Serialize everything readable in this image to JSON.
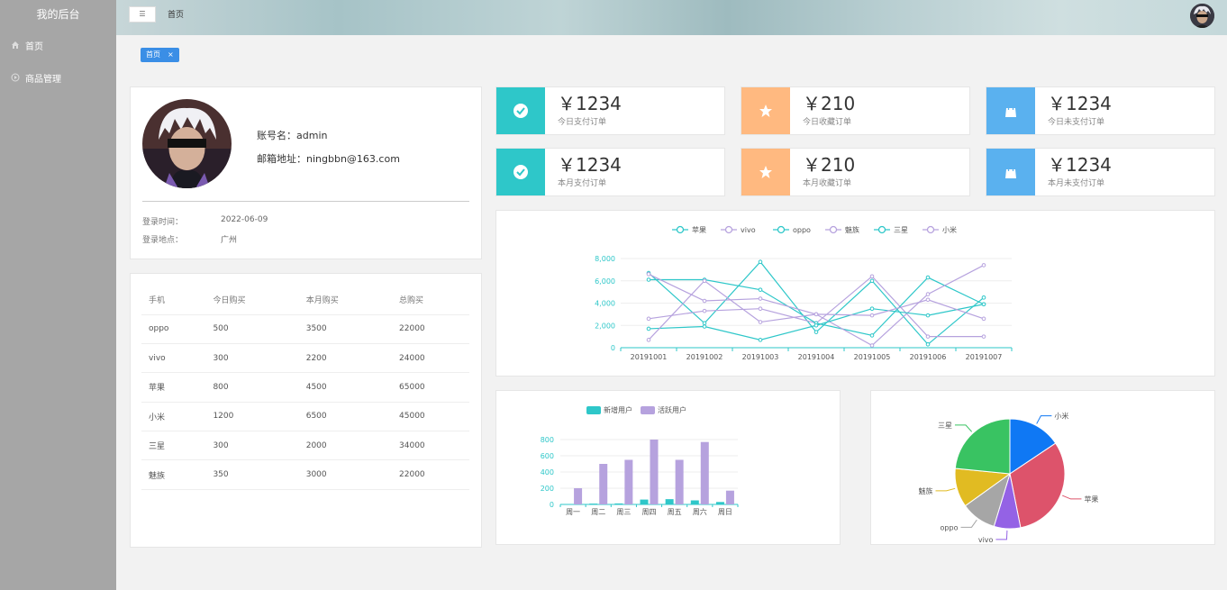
{
  "sidebar": {
    "brand": "我的后台",
    "items": [
      {
        "label": "首页",
        "icon": "home-icon"
      },
      {
        "label": "商品管理",
        "icon": "play-circle-icon"
      }
    ]
  },
  "header": {
    "collapse_label": "☰",
    "breadcrumb": "首页"
  },
  "tabs": [
    {
      "label": "首页",
      "close": "×"
    }
  ],
  "user": {
    "account_label": "账号名：",
    "account": "admin",
    "email_label": "邮箱地址：",
    "email": "ningbbn@163.com",
    "login_time_label": "登录时间：",
    "login_time": "2022-06-09",
    "login_place_label": "登录地点：",
    "login_place": "广州"
  },
  "purchase_table": {
    "headers": [
      "手机",
      "今日购买",
      "本月购买",
      "总购买"
    ],
    "rows": [
      [
        "oppo",
        "500",
        "3500",
        "22000"
      ],
      [
        "vivo",
        "300",
        "2200",
        "24000"
      ],
      [
        "苹果",
        "800",
        "4500",
        "65000"
      ],
      [
        "小米",
        "1200",
        "6500",
        "45000"
      ],
      [
        "三星",
        "300",
        "2000",
        "34000"
      ],
      [
        "魅族",
        "350",
        "3000",
        "22000"
      ]
    ]
  },
  "stats": [
    {
      "value": "￥1234",
      "label": "今日支付订单",
      "icon": "check-circle-icon",
      "color": "#2ec7c9"
    },
    {
      "value": "￥210",
      "label": "今日收藏订单",
      "icon": "star-icon",
      "color": "#ffb980"
    },
    {
      "value": "￥1234",
      "label": "今日未支付订单",
      "icon": "shopping-bag-icon",
      "color": "#5ab1ef"
    },
    {
      "value": "￥1234",
      "label": "本月支付订单",
      "icon": "check-circle-icon",
      "color": "#2ec7c9"
    },
    {
      "value": "￥210",
      "label": "本月收藏订单",
      "icon": "star-icon",
      "color": "#ffb980"
    },
    {
      "value": "￥1234",
      "label": "本月未支付订单",
      "icon": "shopping-bag-icon",
      "color": "#5ab1ef"
    }
  ],
  "chart_data": [
    {
      "type": "line",
      "x": [
        "20191001",
        "20191002",
        "20191003",
        "20191004",
        "20191005",
        "20191006",
        "20191007"
      ],
      "ylim": [
        0,
        8000
      ],
      "yticks": [
        "0",
        "2,000",
        "4,000",
        "6,000",
        "8,000"
      ],
      "legend_position": "top-center",
      "series": [
        {
          "name": "苹果",
          "color": "#2ec7c9",
          "values": [
            6700,
            2200,
            7700,
            1400,
            6000,
            300,
            4500
          ]
        },
        {
          "name": "vivo",
          "color": "#b6a2de",
          "values": [
            2600,
            3300,
            3500,
            2200,
            6400,
            1000,
            1000
          ]
        },
        {
          "name": "oppo",
          "color": "#2ec7c9",
          "values": [
            6100,
            6100,
            5200,
            2200,
            1100,
            6300,
            3900
          ]
        },
        {
          "name": "魅族",
          "color": "#b6a2de",
          "values": [
            6600,
            4200,
            4400,
            3000,
            200,
            4800,
            7400
          ]
        },
        {
          "name": "三星",
          "color": "#2ec7c9",
          "values": [
            1700,
            1900,
            700,
            2000,
            3500,
            2900,
            3900
          ]
        },
        {
          "name": "小米",
          "color": "#b6a2de",
          "values": [
            700,
            6000,
            2300,
            3000,
            2900,
            4300,
            2600
          ]
        }
      ]
    },
    {
      "type": "bar",
      "categories": [
        "周一",
        "周二",
        "周三",
        "周四",
        "周五",
        "周六",
        "周日"
      ],
      "ylim": [
        0,
        800
      ],
      "yticks": [
        "0",
        "200",
        "400",
        "600",
        "800"
      ],
      "legend_position": "top-center",
      "series": [
        {
          "name": "新增用户",
          "color": "#2ec7c9",
          "values": [
            5,
            10,
            12,
            60,
            65,
            50,
            30
          ]
        },
        {
          "name": "活跃用户",
          "color": "#b6a2de",
          "values": [
            200,
            500,
            550,
            800,
            550,
            770,
            170
          ]
        }
      ]
    },
    {
      "type": "pie",
      "slices": [
        {
          "name": "小米",
          "value": 2999,
          "color": "#0f78f4"
        },
        {
          "name": "苹果",
          "value": 5999,
          "color": "#dd536b"
        },
        {
          "name": "vivo",
          "value": 1500,
          "color": "#9462e5"
        },
        {
          "name": "oppo",
          "value": 1999,
          "color": "#a6a6a6"
        },
        {
          "name": "魅族",
          "value": 2200,
          "color": "#e1bb22"
        },
        {
          "name": "三星",
          "value": 4500,
          "color": "#39c362"
        }
      ]
    }
  ]
}
